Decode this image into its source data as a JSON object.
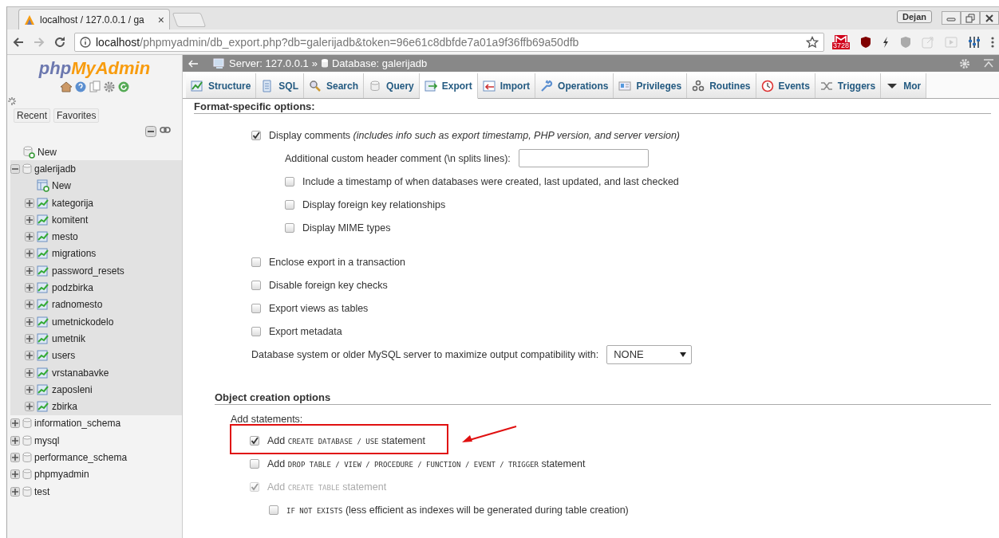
{
  "browser": {
    "tab": {
      "title": "localhost / 127.0.0.1 / ga",
      "close": "×"
    },
    "profile": "Dejan",
    "url": {
      "host": "localhost",
      "path": "/phpmyadmin/db_export.php?db=galerijadb&token=96e61c8dbfde7a01a9f36ffb69a50dfb"
    },
    "mail_badge": "3728"
  },
  "sidebar": {
    "logo": {
      "prefix": "php",
      "name": "MyAdmin"
    },
    "buttons": [
      "Recent",
      "Favorites"
    ],
    "tree": [
      {
        "kind": "new",
        "label": "New"
      },
      {
        "kind": "database",
        "label": "galerijadb",
        "expanded": true,
        "selected": true,
        "children": [
          {
            "kind": "new-table",
            "label": "New"
          },
          {
            "kind": "table",
            "label": "kategorija",
            "expanded": false
          },
          {
            "kind": "table",
            "label": "komitent",
            "expanded": false
          },
          {
            "kind": "table",
            "label": "mesto",
            "expanded": false
          },
          {
            "kind": "table",
            "label": "migrations",
            "expanded": false
          },
          {
            "kind": "table",
            "label": "password_resets",
            "expanded": false
          },
          {
            "kind": "table",
            "label": "podzbirka",
            "expanded": false
          },
          {
            "kind": "table",
            "label": "radnomesto",
            "expanded": false
          },
          {
            "kind": "table",
            "label": "umetnickodelo",
            "expanded": false
          },
          {
            "kind": "table",
            "label": "umetnik",
            "expanded": false
          },
          {
            "kind": "table",
            "label": "users",
            "expanded": false
          },
          {
            "kind": "table",
            "label": "vrstanabavke",
            "expanded": false
          },
          {
            "kind": "table",
            "label": "zaposleni",
            "expanded": false
          },
          {
            "kind": "table",
            "label": "zbirka",
            "expanded": false
          }
        ]
      },
      {
        "kind": "database",
        "label": "information_schema",
        "expanded": false,
        "selected": false
      },
      {
        "kind": "database",
        "label": "mysql",
        "expanded": false,
        "selected": false
      },
      {
        "kind": "database",
        "label": "performance_schema",
        "expanded": false,
        "selected": false
      },
      {
        "kind": "database",
        "label": "phpmyadmin",
        "expanded": false,
        "selected": false
      },
      {
        "kind": "database",
        "label": "test",
        "expanded": false,
        "selected": false
      }
    ]
  },
  "breadcrumb": {
    "server": "Server: 127.0.0.1",
    "separator": "»",
    "database": "Database: galerijadb"
  },
  "tabs": [
    {
      "label": "Structure",
      "selected": false
    },
    {
      "label": "SQL",
      "selected": false
    },
    {
      "label": "Search",
      "selected": false
    },
    {
      "label": "Query",
      "selected": false
    },
    {
      "label": "Export",
      "selected": true
    },
    {
      "label": "Import",
      "selected": false
    },
    {
      "label": "Operations",
      "selected": false
    },
    {
      "label": "Privileges",
      "selected": false
    },
    {
      "label": "Routines",
      "selected": false
    },
    {
      "label": "Events",
      "selected": false
    },
    {
      "label": "Triggers",
      "selected": false
    },
    {
      "label": "Mor",
      "selected": false
    }
  ],
  "sections": [
    {
      "title": "Format-specific options:",
      "items": [
        {
          "kind": "checkbox",
          "label": "Display comments *(includes info such as export timestamp, PHP version, and server version)*",
          "checked": true,
          "disabled": false,
          "children": [
            {
              "kind": "text-field",
              "label": "Additional custom header comment (\\n splits lines):"
            },
            {
              "kind": "checkbox",
              "label": "Include a timestamp of when databases were created, last updated, and last checked",
              "checked": false,
              "disabled": false
            },
            {
              "kind": "checkbox",
              "label": "Display foreign key relationships",
              "checked": false,
              "disabled": false
            },
            {
              "kind": "checkbox",
              "label": "Display MIME types",
              "checked": false,
              "disabled": false
            }
          ]
        },
        {
          "kind": "checkbox",
          "label": "Enclose export in a transaction",
          "checked": false,
          "disabled": false
        },
        {
          "kind": "checkbox",
          "label": "Disable foreign key checks",
          "checked": false,
          "disabled": false
        },
        {
          "kind": "checkbox",
          "label": "Export views as tables",
          "checked": false,
          "disabled": false
        },
        {
          "kind": "checkbox",
          "label": "Export metadata",
          "checked": false,
          "disabled": false
        },
        {
          "kind": "select",
          "label": "Database system or older MySQL server to maximize output compatibility with:",
          "value": "NONE"
        }
      ]
    },
    {
      "title": "Object creation options",
      "items": [
        {
          "kind": "label",
          "label": "Add statements:",
          "children": [
            {
              "kind": "checkbox",
              "parts": [
                {
                  "kind": "text",
                  "text": "Add "
                },
                {
                  "kind": "code",
                  "text": "CREATE DATABASE / USE"
                },
                {
                  "kind": "text",
                  "text": " statement"
                }
              ],
              "checked": true,
              "disabled": false,
              "highlighted": true
            },
            {
              "kind": "checkbox",
              "parts": [
                {
                  "kind": "text",
                  "text": "Add "
                },
                {
                  "kind": "code",
                  "text": "DROP TABLE / VIEW / PROCEDURE / FUNCTION / EVENT / TRIGGER"
                },
                {
                  "kind": "text",
                  "text": " statement"
                }
              ],
              "checked": false,
              "disabled": false,
              "highlighted": false
            },
            {
              "kind": "checkbox",
              "parts": [
                {
                  "kind": "text",
                  "text": "Add "
                },
                {
                  "kind": "code",
                  "text": "CREATE TABLE"
                },
                {
                  "kind": "text",
                  "text": " statement"
                }
              ],
              "checked": true,
              "disabled": true,
              "highlighted": false,
              "children": [
                {
                  "kind": "checkbox",
                  "parts": [
                    {
                      "kind": "code",
                      "text": "IF NOT EXISTS"
                    },
                    {
                      "kind": "text",
                      "text": " (less efficient as indexes will be generated during table creation)"
                    }
                  ],
                  "checked": false,
                  "disabled": false,
                  "highlighted": false
                }
              ]
            }
          ]
        }
      ]
    }
  ]
}
